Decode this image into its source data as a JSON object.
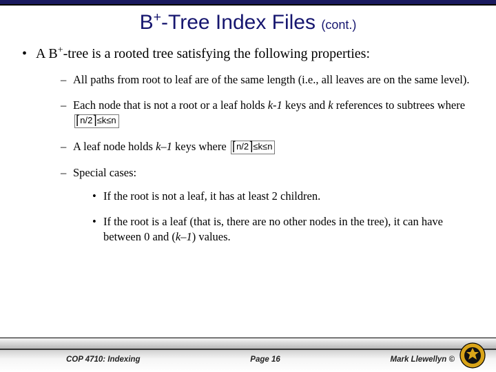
{
  "title": {
    "main_pre": "B",
    "main_sup": "+",
    "main_post": "-Tree Index Files",
    "cont": "(cont.)"
  },
  "bullets": {
    "lead_pre": "A B",
    "lead_sup": "+",
    "lead_post": "-tree is a rooted tree satisfying the following properties:",
    "p1": "All paths from root to leaf are of the same length (i.e., all leaves are on the same level).",
    "p2_pre": "Each node that is not a root or a leaf holds ",
    "p2_k1": "k-1",
    "p2_mid": " keys and ",
    "p2_k2": "k",
    "p2_post": " references to subtrees where ",
    "p3_pre": "A leaf node holds ",
    "p3_k": "k–1",
    "p3_post": " keys where ",
    "p4": "Special cases:",
    "p4a": "If the root is not a leaf, it has at least 2 children.",
    "p4b_pre": "If the root is a leaf (that is, there are no other nodes in the tree), it can have between 0 and (",
    "p4b_k": "k–1",
    "p4b_post": ") values."
  },
  "math": {
    "ceil_open": "⌈",
    "ceil_expr": "n/2",
    "ceil_close": "⌉",
    "le": "≤",
    "k": "k",
    "n": "n"
  },
  "footer": {
    "course": "COP 4710: Indexing",
    "page": "Page 16",
    "author": "Mark Llewellyn ©"
  }
}
